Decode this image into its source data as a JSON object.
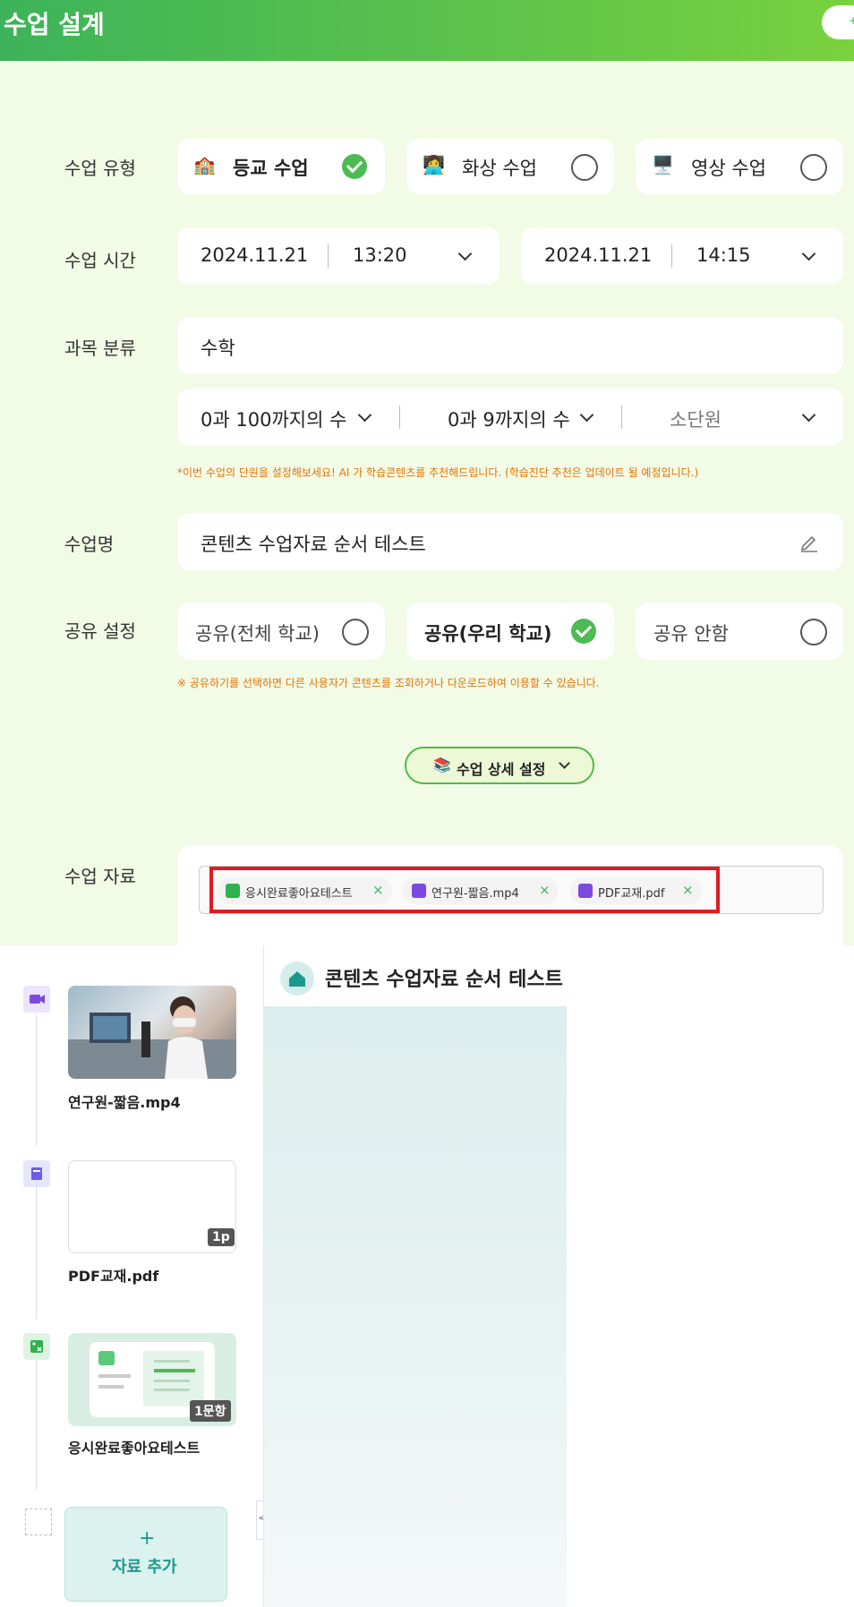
{
  "header": {
    "title": "수업 설계",
    "right_button": "+"
  },
  "form": {
    "type_label": "수업 유형",
    "type_options": [
      {
        "icon": "🏫",
        "label": "등교 수업",
        "selected": true
      },
      {
        "icon": "👩‍💻",
        "label": "화상 수업",
        "selected": false
      },
      {
        "icon": "🖥️",
        "label": "영상 수업",
        "selected": false
      }
    ],
    "time_label": "수업 시간",
    "start": {
      "date": "2024.11.21",
      "time": "13:20"
    },
    "end": {
      "date": "2024.11.21",
      "time": "14:15"
    },
    "subject_label": "과목 분류",
    "subject_value": "수학",
    "unit_selects": [
      "0과 100까지의 수",
      "0과 9까지의 수"
    ],
    "unit_placeholder": "소단원",
    "unit_note": "*이번 수업의 단원을 설정해보세요! AI 가 학습콘텐츠를 추천해드립니다. (학습진단 추천은 업데이트 될 예정입니다.)",
    "name_label": "수업명",
    "name_value": "콘텐츠 수업자료 순서 테스트",
    "share_label": "공유 설정",
    "share_options": [
      {
        "label": "공유(전체 학교)",
        "selected": false
      },
      {
        "label": "공유(우리 학교)",
        "selected": true
      },
      {
        "label": "공유 안함",
        "selected": false
      }
    ],
    "share_note": "※ 공유하기를 선택하면 다른 사용자가 콘텐츠를 조회하거나 다운로드하여 이용할 수 있습니다.",
    "detail_button": {
      "icon": "📚",
      "label": "수업 상세 설정"
    },
    "materials_label": "수업 자료",
    "materials": [
      {
        "name": "응시완료좋아요테스트",
        "color": "#2fb24f"
      },
      {
        "name": "연구원-짧음.mp4",
        "color": "#7b4ae0"
      },
      {
        "name": "PDF교재.pdf",
        "color": "#7b4ae0"
      }
    ],
    "chip_remove": "×"
  },
  "timeline": {
    "items": [
      {
        "type": "video",
        "name": "연구원-짧음.mp4",
        "badge": ""
      },
      {
        "type": "pdf",
        "name": "PDF교재.pdf",
        "badge": "1p"
      },
      {
        "type": "quiz",
        "name": "응시완료좋아요테스트",
        "badge": "1문항"
      }
    ],
    "add_icon": "+",
    "add_label": "자료 추가",
    "collapse_icon": "<"
  },
  "preview": {
    "title": "콘텐츠 수업자료 순서 테스트"
  },
  "colors": {
    "accent": "#4cbc52",
    "header_start": "#3db359",
    "header_end": "#79d23e",
    "form_bg": "#f2fbe5",
    "note": "#e5730a",
    "highlight_box": "#e01b24",
    "teal": "#1a9a8f"
  }
}
